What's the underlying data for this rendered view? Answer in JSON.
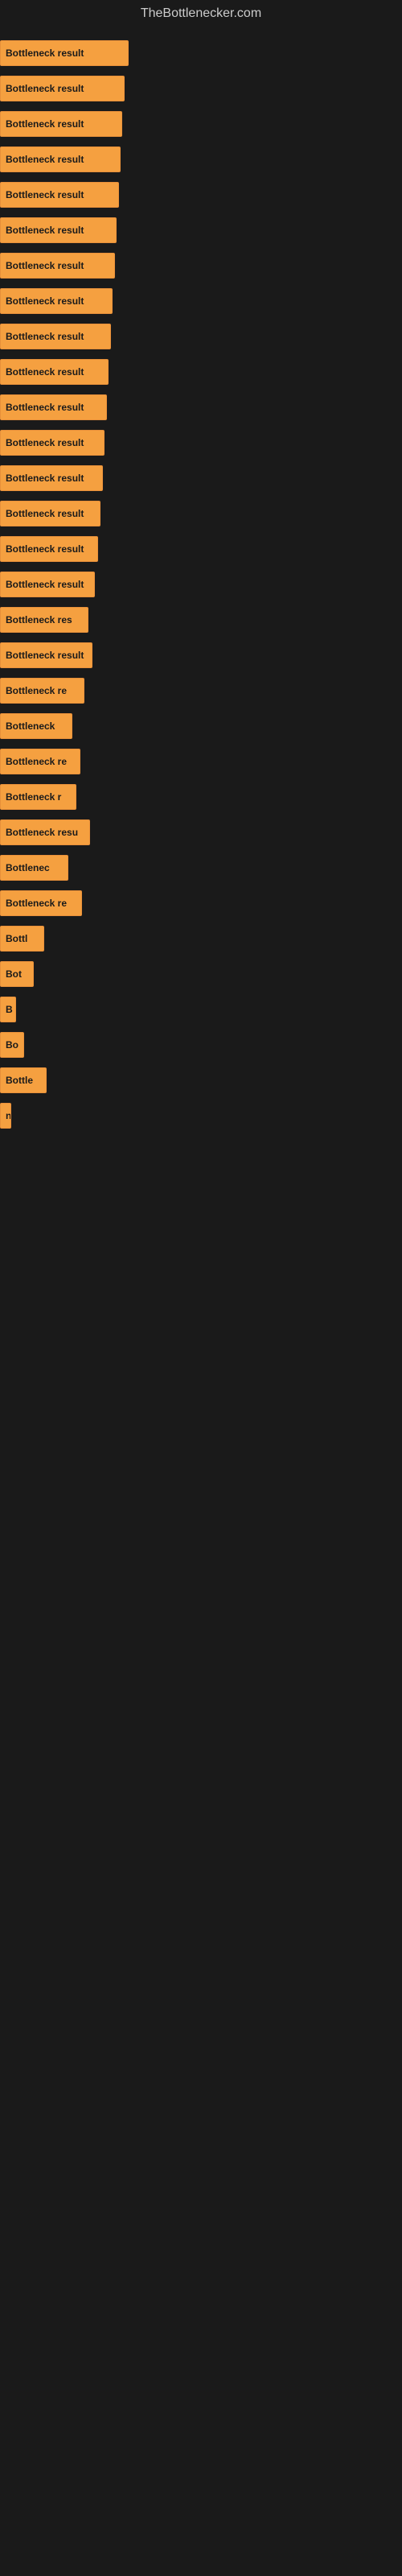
{
  "site": {
    "title": "TheBottlenecker.com"
  },
  "bars": [
    {
      "label": "Bottleneck result",
      "width": 160
    },
    {
      "label": "Bottleneck result",
      "width": 155
    },
    {
      "label": "Bottleneck result",
      "width": 152
    },
    {
      "label": "Bottleneck result",
      "width": 150
    },
    {
      "label": "Bottleneck result",
      "width": 148
    },
    {
      "label": "Bottleneck result",
      "width": 145
    },
    {
      "label": "Bottleneck result",
      "width": 143
    },
    {
      "label": "Bottleneck result",
      "width": 140
    },
    {
      "label": "Bottleneck result",
      "width": 138
    },
    {
      "label": "Bottleneck result",
      "width": 135
    },
    {
      "label": "Bottleneck result",
      "width": 133
    },
    {
      "label": "Bottleneck result",
      "width": 130
    },
    {
      "label": "Bottleneck result",
      "width": 128
    },
    {
      "label": "Bottleneck result",
      "width": 125
    },
    {
      "label": "Bottleneck result",
      "width": 122
    },
    {
      "label": "Bottleneck result",
      "width": 118
    },
    {
      "label": "Bottleneck res",
      "width": 110
    },
    {
      "label": "Bottleneck result",
      "width": 115
    },
    {
      "label": "Bottleneck re",
      "width": 105
    },
    {
      "label": "Bottleneck",
      "width": 90
    },
    {
      "label": "Bottleneck re",
      "width": 100
    },
    {
      "label": "Bottleneck r",
      "width": 95
    },
    {
      "label": "Bottleneck resu",
      "width": 112
    },
    {
      "label": "Bottlenec",
      "width": 85
    },
    {
      "label": "Bottleneck re",
      "width": 102
    },
    {
      "label": "Bottl",
      "width": 55
    },
    {
      "label": "Bot",
      "width": 42
    },
    {
      "label": "B",
      "width": 20
    },
    {
      "label": "Bo",
      "width": 30
    },
    {
      "label": "Bottle",
      "width": 58
    },
    {
      "label": "n",
      "width": 14
    },
    {
      "label": "",
      "width": 0
    },
    {
      "label": "",
      "width": 0
    },
    {
      "label": "",
      "width": 0
    },
    {
      "label": "",
      "width": 0
    },
    {
      "label": "",
      "width": 0
    }
  ]
}
